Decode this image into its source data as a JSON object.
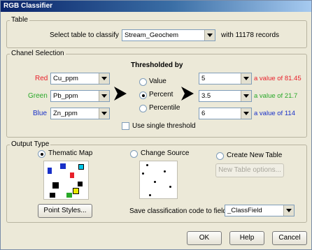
{
  "window": {
    "title": "RGB Classifier"
  },
  "table_group": {
    "legend": "Table",
    "select_label": "Select table to classify",
    "table_value": "Stream_Geochem",
    "records_text": "with 11178 records"
  },
  "channel_group": {
    "legend": "Chanel Selection",
    "thresholded_by": "Thresholded by",
    "channels": [
      {
        "name": "Red",
        "field": "Cu_ppm",
        "threshold": "5",
        "value_text": "a value of 81.45",
        "color": "#e8202a"
      },
      {
        "name": "Green",
        "field": "Pb_ppm",
        "threshold": "3.5",
        "value_text": "a value of 21.7",
        "color": "#28a828"
      },
      {
        "name": "Blue",
        "field": "Zn_ppm",
        "threshold": "6",
        "value_text": "a value of 114",
        "color": "#1830c8"
      }
    ],
    "methods": [
      {
        "label": "Value",
        "selected": false
      },
      {
        "label": "Percent",
        "selected": true
      },
      {
        "label": "Percentile",
        "selected": false
      }
    ],
    "single_threshold_label": "Use single threshold",
    "single_threshold_checked": false
  },
  "output_group": {
    "legend": "Output Type",
    "options": [
      {
        "label": "Thematic Map",
        "selected": true
      },
      {
        "label": "Change Source",
        "selected": false
      },
      {
        "label": "Create New Table",
        "selected": false
      }
    ],
    "new_table_button": "New Table options...",
    "point_styles_button": "Point Styles...",
    "save_label": "Save classification code to field",
    "save_field": "_ClassField",
    "thematic_colors": [
      "#1830c8",
      "#1830c8",
      "#00c8e8",
      "#e8202a",
      "#000000",
      "#000000",
      "#e8e800",
      "#28a828",
      "#000000"
    ]
  },
  "buttons": {
    "ok": "OK",
    "help": "Help",
    "cancel": "Cancel"
  }
}
